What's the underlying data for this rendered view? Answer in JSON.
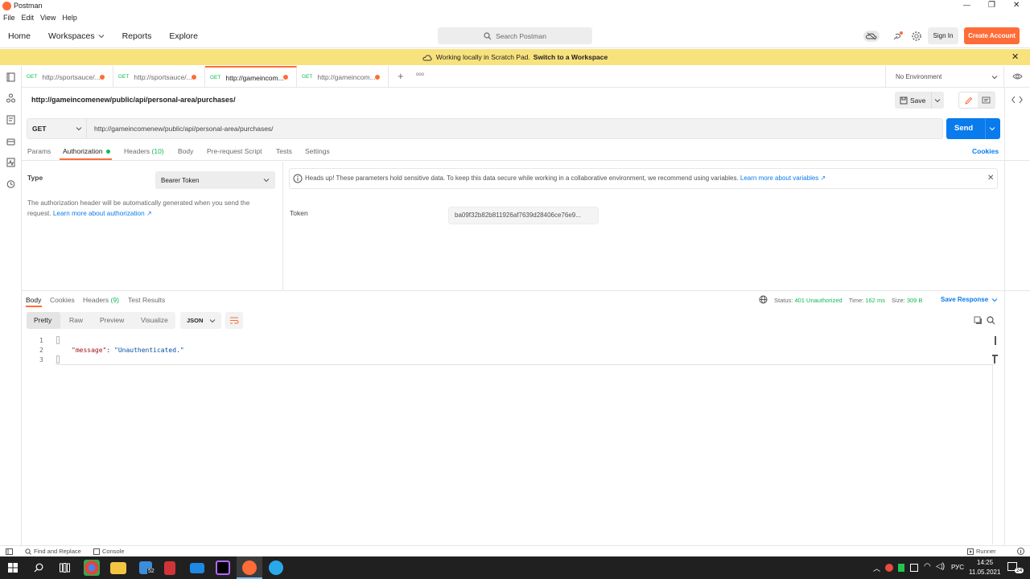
{
  "window": {
    "title": "Postman",
    "menu": [
      "File",
      "Edit",
      "View",
      "Help"
    ],
    "controls": {
      "minimize": "—",
      "maximize": "❐",
      "close": "✕"
    }
  },
  "topnav": {
    "home": "Home",
    "workspaces": "Workspaces",
    "reports": "Reports",
    "explore": "Explore",
    "search_placeholder": "Search Postman",
    "sign_in": "Sign In",
    "create_account": "Create Account"
  },
  "banner": {
    "text": "Working locally in Scratch Pad.",
    "link": "Switch to a Workspace"
  },
  "tabs": [
    {
      "method": "GET",
      "label": "http://sportsauce/...",
      "unsaved": true
    },
    {
      "method": "GET",
      "label": "http://sportsauce/...",
      "unsaved": true
    },
    {
      "method": "GET",
      "label": "http://gameincom...",
      "unsaved": true,
      "active": true
    },
    {
      "method": "GET",
      "label": "http://gameincom...",
      "unsaved": true
    }
  ],
  "tabbar_extra": {
    "add": "+",
    "more": "ooo"
  },
  "environment": {
    "label": "No Environment"
  },
  "request": {
    "title": "http://gameincomenew/public/api/personal-area/purchases/",
    "method": "GET",
    "url": "http://gameincomenew/public/api/personal-area/purchases/",
    "save": "Save",
    "send": "Send"
  },
  "request_tabs": [
    {
      "label": "Params"
    },
    {
      "label": "Authorization",
      "active": true
    },
    {
      "label": "Headers",
      "count": "(10)"
    },
    {
      "label": "Body"
    },
    {
      "label": "Pre-request Script"
    },
    {
      "label": "Tests"
    },
    {
      "label": "Settings"
    }
  ],
  "cookies_link": "Cookies",
  "auth": {
    "type_label": "Type",
    "type_value": "Bearer Token",
    "description": "The authorization header will be automatically generated when you send the request.",
    "learn_more": "Learn more about authorization ↗",
    "warning": "Heads up! These parameters hold sensitive data. To keep this data secure while working in a collaborative environment, we recommend using variables.",
    "warning_link": "Learn more about variables ↗",
    "token_label": "Token",
    "token_value": "ba09f32b82b811926af7639d28406ce76e9..."
  },
  "response": {
    "tabs": [
      {
        "label": "Body",
        "active": true
      },
      {
        "label": "Cookies"
      },
      {
        "label": "Headers",
        "count": "(9)"
      },
      {
        "label": "Test Results"
      }
    ],
    "status_label": "Status:",
    "status_value": "401 Unauthorized",
    "time_label": "Time:",
    "time_value": "162 ms",
    "size_label": "Size:",
    "size_value": "309 B",
    "save_response": "Save Response",
    "view_modes": [
      "Pretty",
      "Raw",
      "Preview",
      "Visualize"
    ],
    "format": "JSON",
    "code": {
      "line_numbers": [
        "1",
        "2",
        "3"
      ],
      "key": "\"message\"",
      "colon": ": ",
      "value": "\"Unauthenticated.\""
    }
  },
  "footer": {
    "find_replace": "Find and Replace",
    "console": "Console",
    "runner": "Runner"
  },
  "taskbar": {
    "badge": "52",
    "lang": "РУС",
    "time": "14:25",
    "date": "11.05.2021",
    "notif": "24"
  },
  "colors": {
    "orange": "#ff6c37",
    "blue": "#097bed",
    "green": "#0cbb52",
    "banner": "#f8e27e"
  }
}
